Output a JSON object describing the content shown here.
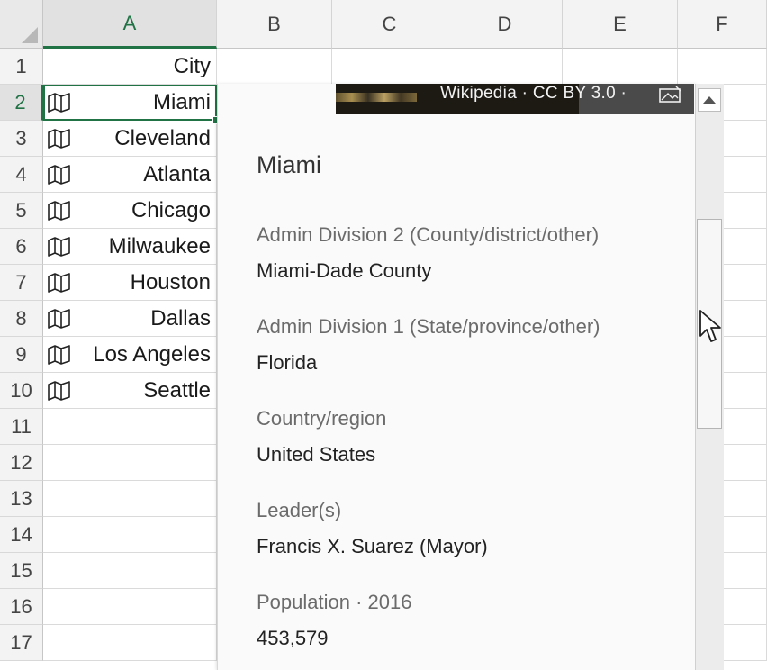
{
  "columns": [
    "A",
    "B",
    "C",
    "D",
    "E",
    "F"
  ],
  "selected_column": "A",
  "rows": [
    "1",
    "2",
    "3",
    "4",
    "5",
    "6",
    "7",
    "8",
    "9",
    "10",
    "11",
    "12",
    "13",
    "14",
    "15",
    "16",
    "17"
  ],
  "selected_row": "2",
  "header_cell": "City",
  "cities": [
    "Miami",
    "Cleveland",
    "Atlanta",
    "Chicago",
    "Milwaukee",
    "Houston",
    "Dallas",
    "Los Angeles",
    "Seattle"
  ],
  "card": {
    "image_credit": "Wikipedia · CC BY 3.0 ·",
    "title": "Miami",
    "fields": [
      {
        "label": "Admin Division 2 (County/district/other)",
        "value": "Miami-Dade County"
      },
      {
        "label": "Admin Division 1 (State/province/other)",
        "value": "Florida"
      },
      {
        "label": "Country/region",
        "value": "United States"
      },
      {
        "label": "Leader(s)",
        "value": "Francis X. Suarez (Mayor)"
      },
      {
        "label": "Population · 2016",
        "value": "453,579"
      }
    ]
  },
  "icons": {
    "geography": "map-icon",
    "image_toggle": "image-icon",
    "scroll_up": "chevron-up-icon",
    "cursor": "mouse-pointer-icon"
  },
  "colors": {
    "accent": "#217346",
    "card_bg": "#fafafa",
    "label": "#6b6b6b"
  }
}
